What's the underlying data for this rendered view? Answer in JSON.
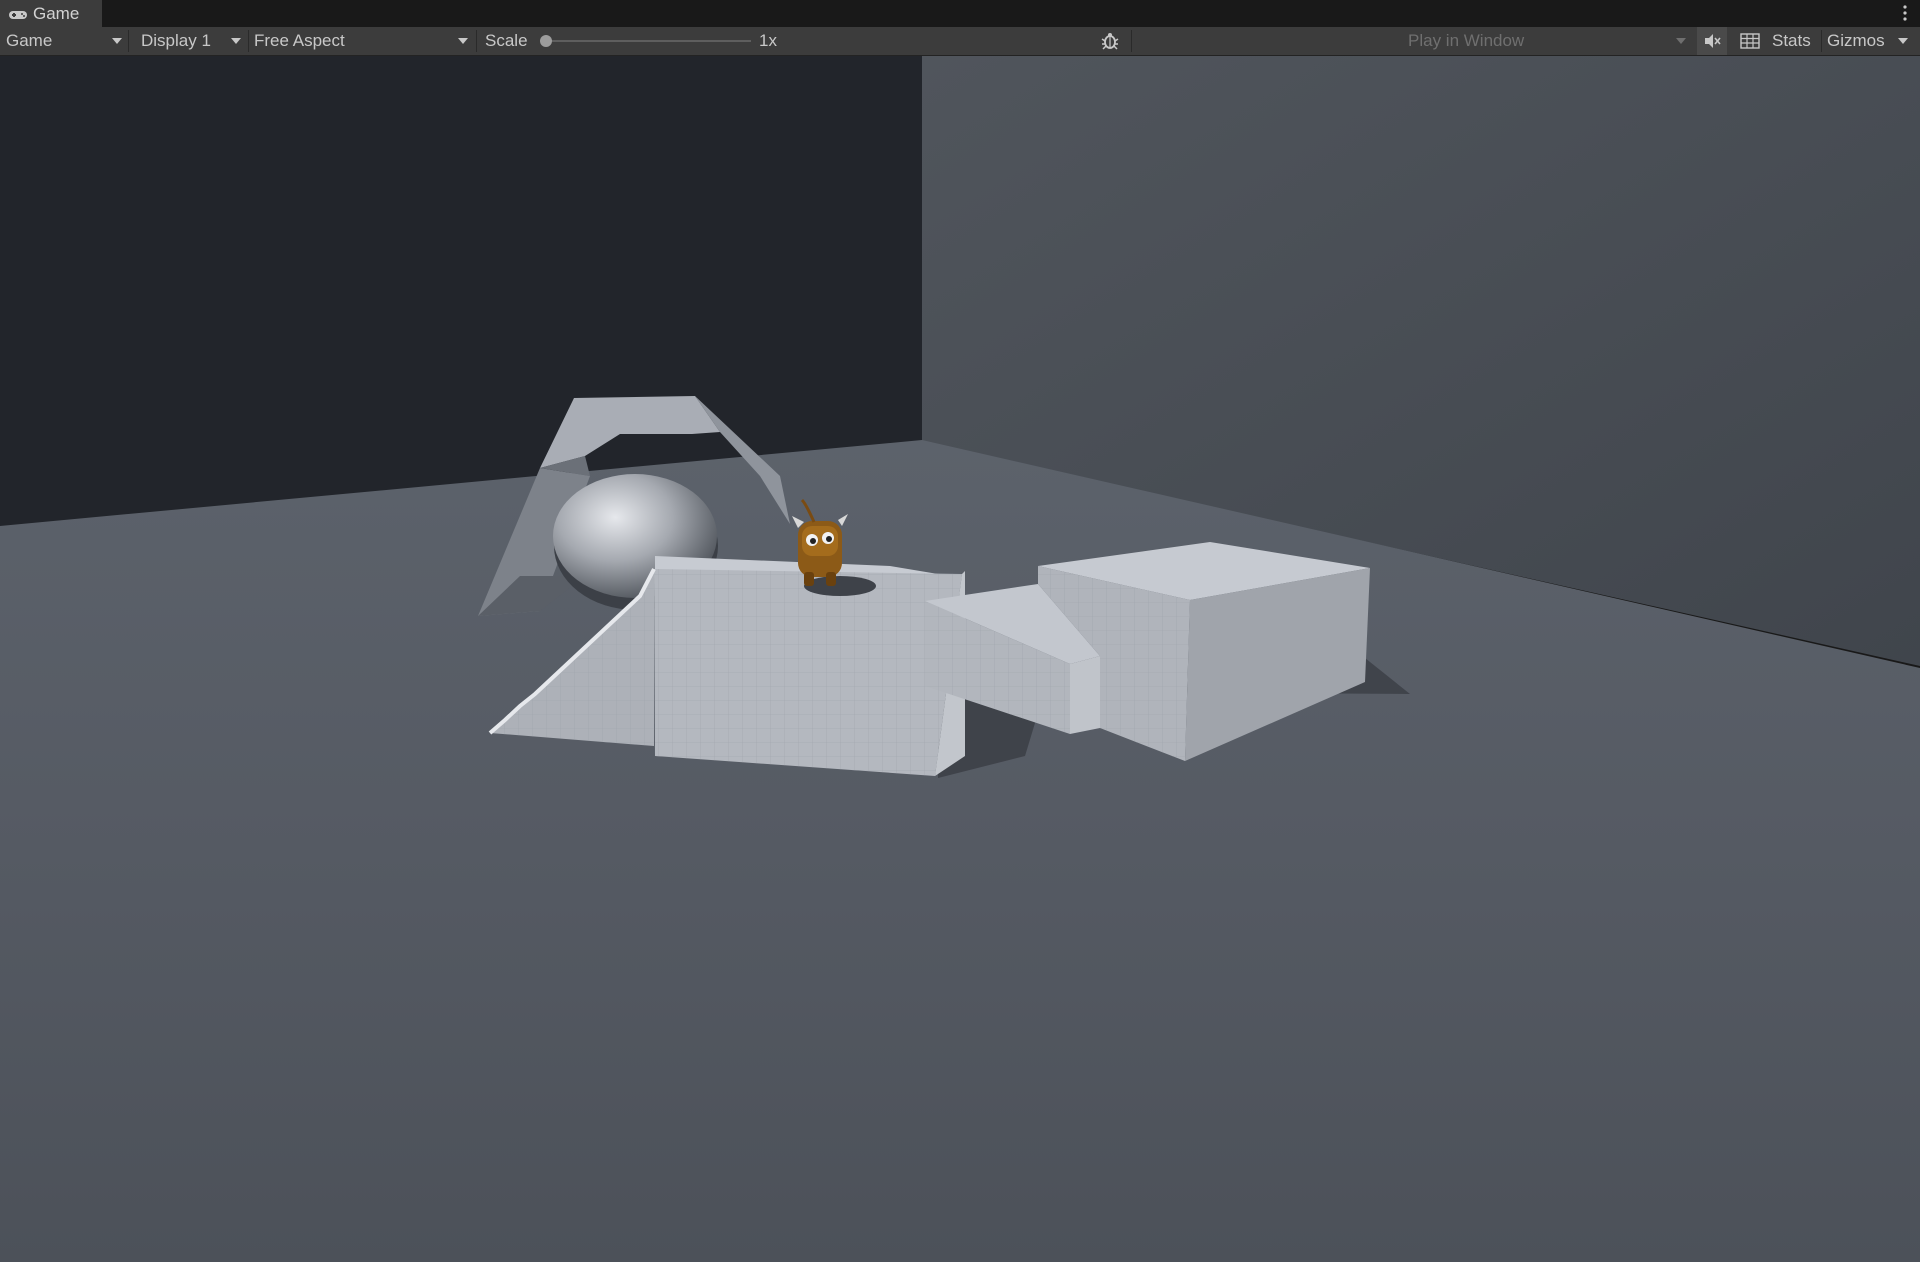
{
  "tab": {
    "label": "Game",
    "icon": "gamepad-icon"
  },
  "toolbar": {
    "view_mode": "Game",
    "display": "Display 1",
    "aspect": "Free Aspect",
    "scale_label": "Scale",
    "scale_value": "1x",
    "scale_fraction": 0.0,
    "play_mode": "Play in Window",
    "stats_label": "Stats",
    "gizmos_label": "Gizmos"
  },
  "icons": {
    "debug": "bug-icon",
    "mute": "mute-audio-icon",
    "grid": "grid-icon",
    "menu": "kebab-menu-icon"
  },
  "colors": {
    "panel": "#3c3c3c",
    "tabbar": "#191919",
    "back_wall_left": "#22252b",
    "back_wall_right": "#4a4f56",
    "floor": "#555a62",
    "block": "#b8bcc4"
  }
}
